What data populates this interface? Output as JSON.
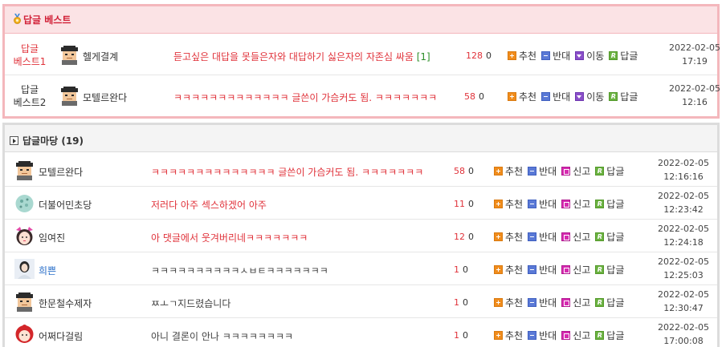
{
  "best": {
    "title": "답글 베스트",
    "rows": [
      {
        "label1": "답글",
        "label2": "베스트1",
        "nick": "헬게결계",
        "avatar": "blackhat-avatar",
        "content": "듣고싶은 대답을 못들은자와 대답하기 싫은자의 자존심 싸움",
        "count": "[1]",
        "up": "128",
        "down": "0",
        "actions": [
          "추천",
          "반대",
          "이동",
          "답글"
        ],
        "date": "2022-02-05",
        "time": "17:19"
      },
      {
        "label1": "답글",
        "label2": "베스트2",
        "nick": "모텔르완다",
        "avatar": "blackhat-avatar",
        "content": "ㅋㅋㅋㅋㅋㅋㅋㅋㅋㅋㅋㅋㅋ 글쓴이 가슴커도 됨. ㅋㅋㅋㅋㅋㅋㅋ",
        "up": "58",
        "down": "0",
        "actions": [
          "추천",
          "반대",
          "이동",
          "답글"
        ],
        "date": "2022-02-05",
        "time": "12:16"
      }
    ]
  },
  "list": {
    "title": "답글마당 (19)",
    "rows": [
      {
        "nick": "모텔르완다",
        "avatar": "blackhat-avatar",
        "content": "ㅋㅋㅋㅋㅋㅋㅋㅋㅋㅋㅋㅋㅋㅋ 글쓴이 가슴커도 됨. ㅋㅋㅋㅋㅋㅋㅋ",
        "up": "58",
        "down": "0",
        "date": "2022-02-05",
        "time": "12:16:16"
      },
      {
        "nick": "더불어민초당",
        "avatar": "mint-ball-avatar",
        "content": "저러다 아주 섹스하겠어 아주",
        "up": "11",
        "down": "0",
        "date": "2022-02-05",
        "time": "12:23:42"
      },
      {
        "nick": "임여진",
        "avatar": "pink-girl-avatar",
        "content": "아 댓글에서 웃겨버리네ㅋㅋㅋㅋㅋㅋㅋ",
        "up": "12",
        "down": "0",
        "date": "2022-02-05",
        "time": "12:24:18"
      },
      {
        "nick": "희쁜",
        "avatar": "photo-avatar",
        "content": "ㅋㅋㅋㅋㅋㅋㅋㅋㅋㅋㅅㅂㅌㅋㅋㅋㅋㅋㅋㅋ",
        "up": "1",
        "down": "0",
        "date": "2022-02-05",
        "time": "12:25:03"
      },
      {
        "nick": "한문철수제자",
        "avatar": "blackhat-avatar",
        "content": "ㅉㅗㄱ지드렸습니다",
        "up": "1",
        "down": "0",
        "date": "2022-02-05",
        "time": "12:30:47"
      },
      {
        "nick": "어쩌다걸림",
        "avatar": "red-hair-avatar",
        "content": "아니 결론이 안나 ㅋㅋㅋㅋㅋㅋㅋㅋ",
        "up": "1",
        "down": "0",
        "date": "2022-02-05",
        "time": "17:00:08"
      }
    ],
    "actions": [
      "추천",
      "반대",
      "신고",
      "답글"
    ]
  },
  "colors": {
    "accent_red": "#e0323a",
    "best_border": "#f4b7bc",
    "best_header_bg": "#fbe3e5"
  }
}
